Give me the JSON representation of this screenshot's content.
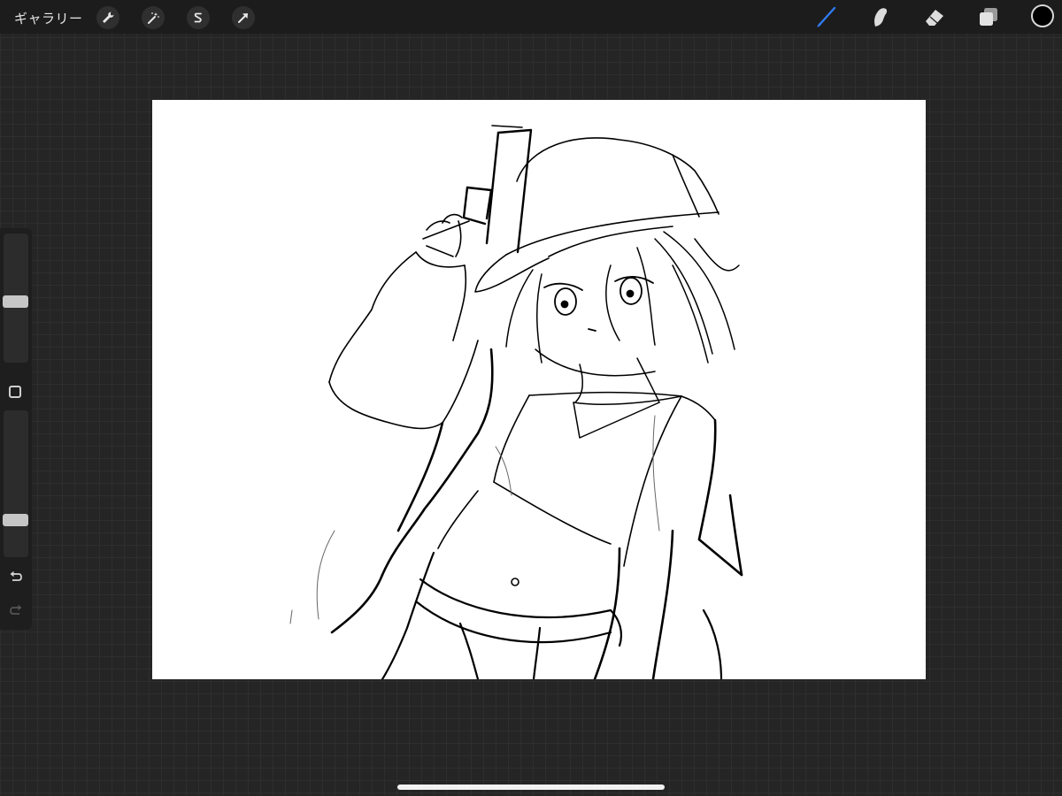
{
  "topbar": {
    "gallery_label": "ギャラリー",
    "left_tools": [
      "wrench-icon",
      "magic-wand-icon",
      "selection-s-icon",
      "transform-arrow-icon"
    ],
    "right_tools": [
      "brush-icon",
      "smudge-icon",
      "eraser-icon",
      "layers-icon"
    ],
    "active_tool": "brush",
    "active_color": "#2f7bf2",
    "current_color": "#000000"
  },
  "sidebar": {
    "brush_size_level": 0.47,
    "opacity_level": 0.23,
    "controls": [
      "modify-square-icon",
      "undo-icon",
      "redo-icon"
    ]
  },
  "canvas": {
    "background": "#ffffff",
    "content": "line-art-sketch"
  }
}
